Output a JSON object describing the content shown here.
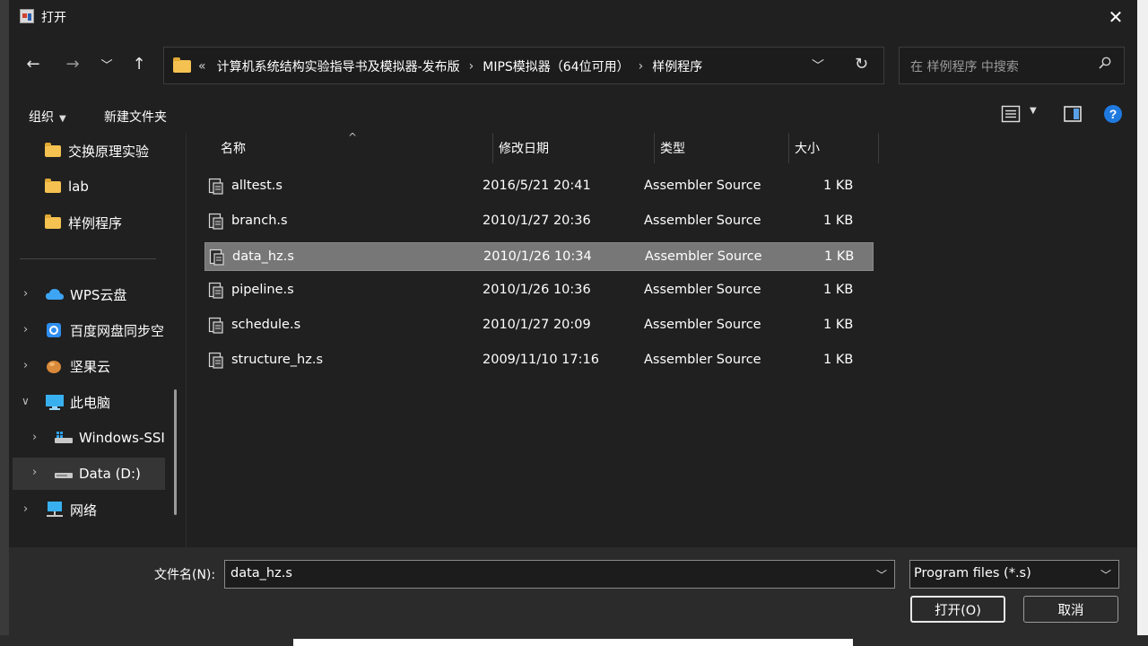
{
  "dialog": {
    "title": "打开"
  },
  "nav": {
    "breadcrumb": [
      "计算机系统结构实验指导书及模拟器-发布版",
      "MIPS模拟器（64位可用）",
      "样例程序"
    ],
    "overflow_marker": "«"
  },
  "search": {
    "placeholder": "在 样例程序 中搜索"
  },
  "toolbar": {
    "organize_label": "组织",
    "new_folder_label": "新建文件夹"
  },
  "sidebar": {
    "items": [
      {
        "label": "交换原理实验",
        "icon": "folder-icon"
      },
      {
        "label": "lab",
        "icon": "folder-icon"
      },
      {
        "label": "样例程序",
        "icon": "folder-icon"
      },
      {
        "label": "WPS云盘",
        "icon": "cloud-icon"
      },
      {
        "label": "百度网盘同步空",
        "icon": "baidu-netdisk-icon"
      },
      {
        "label": "坚果云",
        "icon": "nut-cloud-icon"
      },
      {
        "label": "此电脑",
        "icon": "computer-icon"
      },
      {
        "label": "Windows-SSI",
        "icon": "drive-icon"
      },
      {
        "label": "Data (D:)",
        "icon": "drive-icon"
      },
      {
        "label": "网络",
        "icon": "network-icon"
      }
    ]
  },
  "columns": {
    "name": "名称",
    "modified": "修改日期",
    "type": "类型",
    "size": "大小"
  },
  "files": [
    {
      "name": "alltest.s",
      "modified": "2016/5/21 20:41",
      "type": "Assembler Source",
      "size": "1 KB"
    },
    {
      "name": "branch.s",
      "modified": "2010/1/27 20:36",
      "type": "Assembler Source",
      "size": "1 KB"
    },
    {
      "name": "data_hz.s",
      "modified": "2010/1/26 10:34",
      "type": "Assembler Source",
      "size": "1 KB"
    },
    {
      "name": "pipeline.s",
      "modified": "2010/1/26 10:36",
      "type": "Assembler Source",
      "size": "1 KB"
    },
    {
      "name": "schedule.s",
      "modified": "2010/1/27 20:09",
      "type": "Assembler Source",
      "size": "1 KB"
    },
    {
      "name": "structure_hz.s",
      "modified": "2009/11/10 17:16",
      "type": "Assembler Source",
      "size": "1 KB"
    }
  ],
  "selected_file_index": 2,
  "filename": {
    "label": "文件名(N):",
    "value": "data_hz.s"
  },
  "filetype": {
    "value": "Program files (*.s)"
  },
  "buttons": {
    "open": "打开(O)",
    "cancel": "取消"
  }
}
